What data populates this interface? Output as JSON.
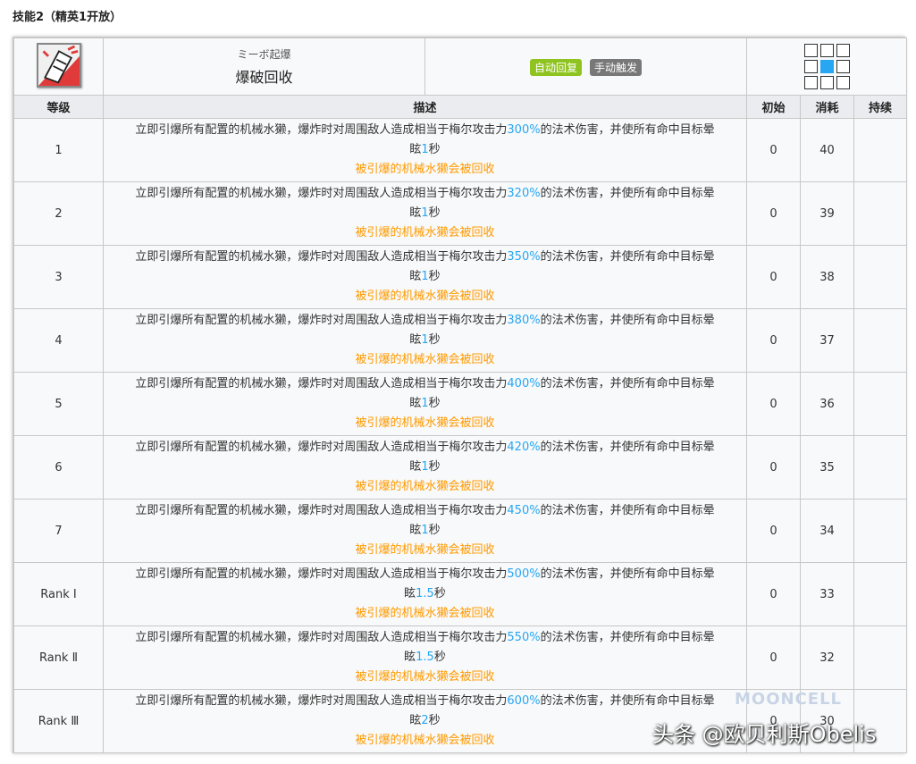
{
  "section_title": "技能2（精英1开放）",
  "skill": {
    "icon": "detonate-skill-icon",
    "name_jp": "ミーボ起爆",
    "name_cn": "爆破回收",
    "tags": [
      "自动回复",
      "手动触发"
    ],
    "range_icon": "attack-range-grid"
  },
  "table_headers": {
    "level": "等级",
    "desc": "描述",
    "initial": "初始",
    "cost": "消耗",
    "duration": "持续"
  },
  "rows": [
    {
      "level": "1",
      "desc_a": "立即引爆所有配置的机械水獭，爆炸时对周围敌人造成相当于梅尔攻击力",
      "pct": "300%",
      "desc_b": "的法术伤害，并使所有命中目标晕",
      "desc_c": "眩",
      "stun": "1",
      "desc_d": "秒",
      "note": "被引爆的机械水獭会被回收",
      "initial": "0",
      "cost": "40",
      "duration": ""
    },
    {
      "level": "2",
      "desc_a": "立即引爆所有配置的机械水獭，爆炸时对周围敌人造成相当于梅尔攻击力",
      "pct": "320%",
      "desc_b": "的法术伤害，并使所有命中目标晕",
      "desc_c": "眩",
      "stun": "1",
      "desc_d": "秒",
      "note": "被引爆的机械水獭会被回收",
      "initial": "0",
      "cost": "39",
      "duration": ""
    },
    {
      "level": "3",
      "desc_a": "立即引爆所有配置的机械水獭，爆炸时对周围敌人造成相当于梅尔攻击力",
      "pct": "350%",
      "desc_b": "的法术伤害，并使所有命中目标晕",
      "desc_c": "眩",
      "stun": "1",
      "desc_d": "秒",
      "note": "被引爆的机械水獭会被回收",
      "initial": "0",
      "cost": "38",
      "duration": ""
    },
    {
      "level": "4",
      "desc_a": "立即引爆所有配置的机械水獭，爆炸时对周围敌人造成相当于梅尔攻击力",
      "pct": "380%",
      "desc_b": "的法术伤害，并使所有命中目标晕",
      "desc_c": "眩",
      "stun": "1",
      "desc_d": "秒",
      "note": "被引爆的机械水獭会被回收",
      "initial": "0",
      "cost": "37",
      "duration": ""
    },
    {
      "level": "5",
      "desc_a": "立即引爆所有配置的机械水獭，爆炸时对周围敌人造成相当于梅尔攻击力",
      "pct": "400%",
      "desc_b": "的法术伤害，并使所有命中目标晕",
      "desc_c": "眩",
      "stun": "1",
      "desc_d": "秒",
      "note": "被引爆的机械水獭会被回收",
      "initial": "0",
      "cost": "36",
      "duration": ""
    },
    {
      "level": "6",
      "desc_a": "立即引爆所有配置的机械水獭，爆炸时对周围敌人造成相当于梅尔攻击力",
      "pct": "420%",
      "desc_b": "的法术伤害，并使所有命中目标晕",
      "desc_c": "眩",
      "stun": "1",
      "desc_d": "秒",
      "note": "被引爆的机械水獭会被回收",
      "initial": "0",
      "cost": "35",
      "duration": ""
    },
    {
      "level": "7",
      "desc_a": "立即引爆所有配置的机械水獭，爆炸时对周围敌人造成相当于梅尔攻击力",
      "pct": "450%",
      "desc_b": "的法术伤害，并使所有命中目标晕",
      "desc_c": "眩",
      "stun": "1",
      "desc_d": "秒",
      "note": "被引爆的机械水獭会被回收",
      "initial": "0",
      "cost": "34",
      "duration": ""
    },
    {
      "level": "Rank Ⅰ",
      "desc_a": "立即引爆所有配置的机械水獭，爆炸时对周围敌人造成相当于梅尔攻击力",
      "pct": "500%",
      "desc_b": "的法术伤害，并使所有命中目标晕",
      "desc_c": "眩",
      "stun": "1.5",
      "desc_d": "秒",
      "note": "被引爆的机械水獭会被回收",
      "initial": "0",
      "cost": "33",
      "duration": ""
    },
    {
      "level": "Rank Ⅱ",
      "desc_a": "立即引爆所有配置的机械水獭，爆炸时对周围敌人造成相当于梅尔攻击力",
      "pct": "550%",
      "desc_b": "的法术伤害，并使所有命中目标晕",
      "desc_c": "眩",
      "stun": "1.5",
      "desc_d": "秒",
      "note": "被引爆的机械水獭会被回收",
      "initial": "0",
      "cost": "32",
      "duration": ""
    },
    {
      "level": "Rank Ⅲ",
      "desc_a": "立即引爆所有配置的机械水獭，爆炸时对周围敌人造成相当于梅尔攻击力",
      "pct": "600%",
      "desc_b": "的法术伤害，并使所有命中目标晕",
      "desc_c": "眩",
      "stun": "2",
      "desc_d": "秒",
      "note": "被引爆的机械水獭会被回收",
      "initial": "0",
      "cost": "30",
      "duration": ""
    }
  ],
  "watermarks": {
    "site": "MOONCELL",
    "author": "头条 @欧贝利斯Obelis"
  },
  "colors": {
    "highlight": "#27a6f3",
    "note": "#ff9a00",
    "tag_auto": "#8fc31f",
    "tag_manual": "#787878"
  }
}
